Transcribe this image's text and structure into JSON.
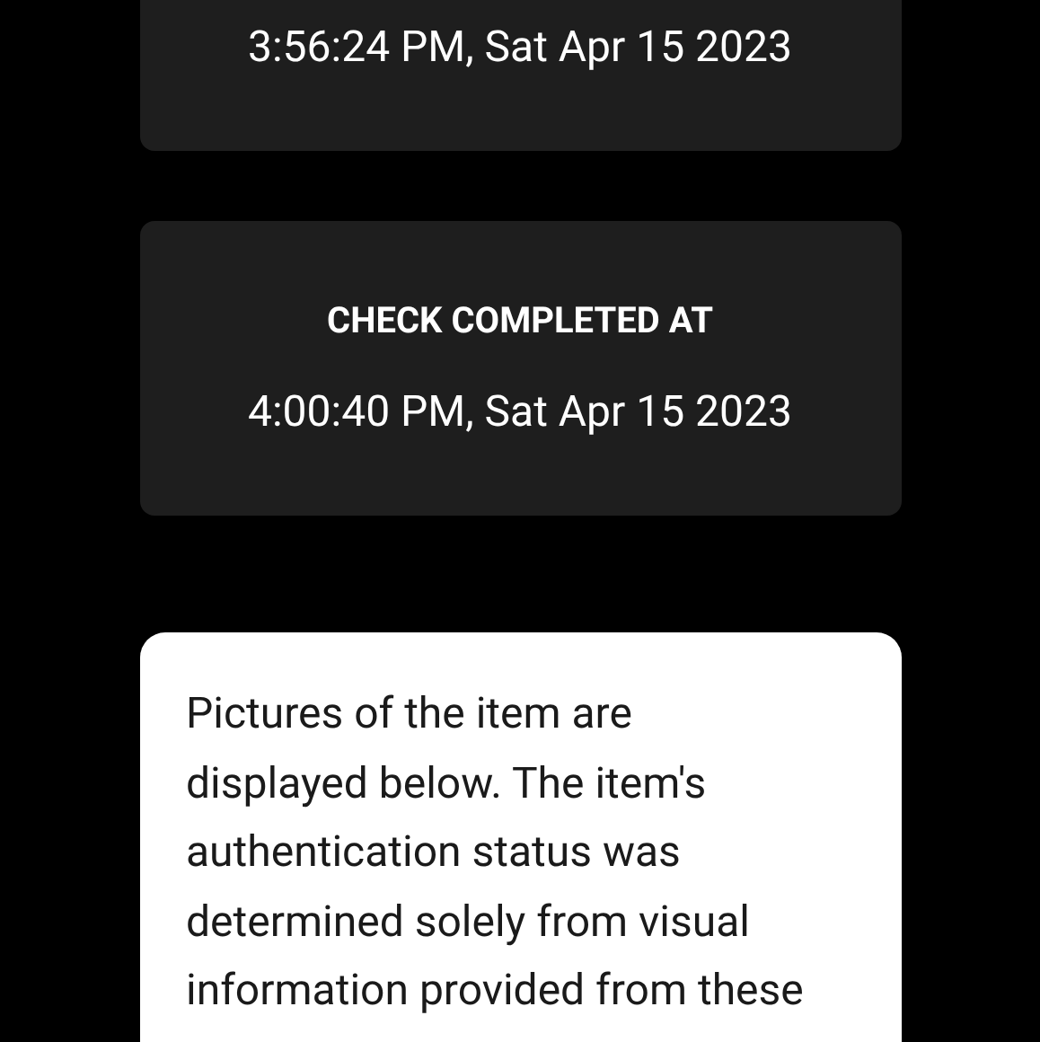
{
  "cards": [
    {
      "time": "3:56:24 PM, Sat Apr 15 2023"
    },
    {
      "heading": "CHECK COMPLETED AT",
      "time": "4:00:40 PM, Sat Apr 15 2023"
    }
  ],
  "notice": {
    "text": "Pictures of the item are displayed below. The item's authentication status was determined solely from visual information provided from these"
  }
}
